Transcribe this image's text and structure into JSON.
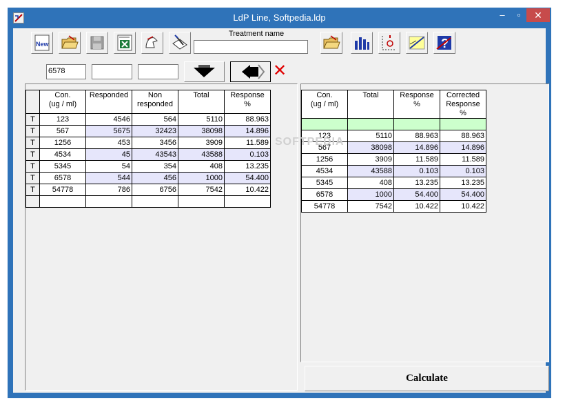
{
  "window": {
    "title": "LdP Line, Softpedia.ldp",
    "min_label": "–",
    "max_label": "▫",
    "close_label": "✕"
  },
  "toolbar": {
    "new_label": "New",
    "treatment_label": "Treatment name",
    "treatment_value": ""
  },
  "entry": {
    "concentration": "6578",
    "responded": "",
    "non_responded": ""
  },
  "left_table": {
    "headers": [
      "Con.\n(ug / ml)",
      "Responded",
      "Non\nresponded",
      "Total",
      "Response\n%"
    ],
    "rows": [
      {
        "mark": "T",
        "con": "123",
        "responded": "4546",
        "non": "564",
        "total": "5110",
        "resp": "88.963"
      },
      {
        "mark": "T",
        "con": "567",
        "responded": "5675",
        "non": "32423",
        "total": "38098",
        "resp": "14.896"
      },
      {
        "mark": "T",
        "con": "1256",
        "responded": "453",
        "non": "3456",
        "total": "3909",
        "resp": "11.589"
      },
      {
        "mark": "T",
        "con": "4534",
        "responded": "45",
        "non": "43543",
        "total": "43588",
        "resp": "0.103"
      },
      {
        "mark": "T",
        "con": "5345",
        "responded": "54",
        "non": "354",
        "total": "408",
        "resp": "13.235"
      },
      {
        "mark": "T",
        "con": "6578",
        "responded": "544",
        "non": "456",
        "total": "1000",
        "resp": "54.400"
      },
      {
        "mark": "T",
        "con": "54778",
        "responded": "786",
        "non": "6756",
        "total": "7542",
        "resp": "10.422"
      }
    ]
  },
  "right_table": {
    "headers": [
      "Con.\n(ug / ml)",
      "Total",
      "Response\n%",
      "Corrected\nResponse\n%"
    ],
    "rows": [
      {
        "con": "123",
        "total": "5110",
        "resp": "88.963",
        "corr": "88.963"
      },
      {
        "con": "567",
        "total": "38098",
        "resp": "14.896",
        "corr": "14.896"
      },
      {
        "con": "1256",
        "total": "3909",
        "resp": "11.589",
        "corr": "11.589"
      },
      {
        "con": "4534",
        "total": "43588",
        "resp": "0.103",
        "corr": "0.103"
      },
      {
        "con": "5345",
        "total": "408",
        "resp": "13.235",
        "corr": "13.235"
      },
      {
        "con": "6578",
        "total": "1000",
        "resp": "54.400",
        "corr": "54.400"
      },
      {
        "con": "54778",
        "total": "7542",
        "resp": "10.422",
        "corr": "10.422"
      }
    ]
  },
  "calculate_label": "Calculate",
  "watermark": "SOFTPEDIA"
}
